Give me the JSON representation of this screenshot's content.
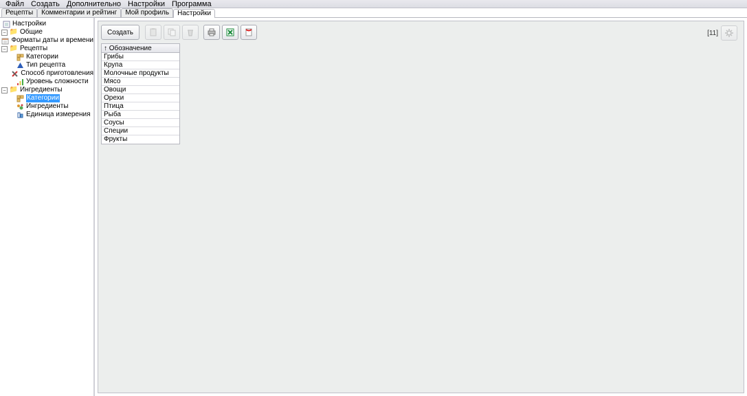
{
  "menu": [
    "Файл",
    "Создать",
    "Дополнительно",
    "Настройки",
    "Программа"
  ],
  "tabs": [
    {
      "label": "Рецепты",
      "active": false
    },
    {
      "label": "Комментарии и рейтинг",
      "active": false
    },
    {
      "label": "Мой профиль",
      "active": false
    },
    {
      "label": "Настройки",
      "active": true
    }
  ],
  "tree": {
    "root": "Настройки",
    "n0": "Общие",
    "n0_0": "Форматы даты и времени",
    "n1": "Рецепты",
    "n1_0": "Категории",
    "n1_1": "Тип рецепта",
    "n1_2": "Способ приготовления",
    "n1_3": "Уровень сложности",
    "n2": "Ингредиенты",
    "n2_0": "Категории",
    "n2_1": "Ингредиенты",
    "n2_2": "Единица измерения"
  },
  "toolbar": {
    "create": "Создать"
  },
  "counter": "[11]",
  "grid": {
    "header": "Обозначение",
    "sort_char": "↑",
    "rows": [
      "Грибы",
      "Крупа",
      "Молочные продукты",
      "Мясо",
      "Овощи",
      "Орехи",
      "Птица",
      "Рыба",
      "Соусы",
      "Специи",
      "Фрукты"
    ]
  }
}
